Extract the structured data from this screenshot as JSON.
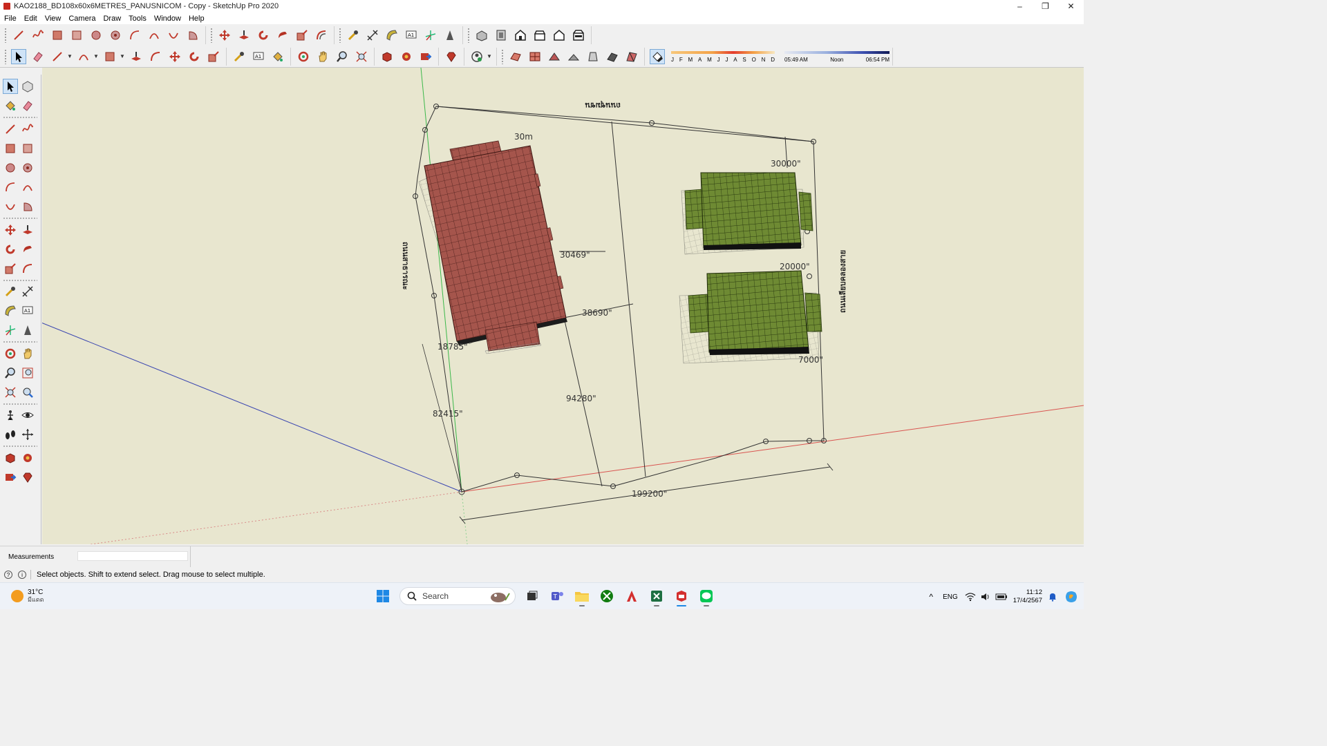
{
  "window": {
    "title": "KAO2188_BD108x60x6METRES_PANUSNICOM - Copy - SketchUp Pro 2020",
    "minimize": "–",
    "restore": "❐",
    "close": "✕"
  },
  "menu": [
    "File",
    "Edit",
    "View",
    "Camera",
    "Draw",
    "Tools",
    "Window",
    "Help"
  ],
  "toolbar_row1_icons": [
    "line-icon",
    "freehand-icon",
    "rectangle-icon",
    "rotated-rectangle-icon",
    "circle-icon",
    "polygon-icon",
    "arc-icon",
    "2pt-arc-icon",
    "3pt-arc-icon",
    "pie-icon",
    "move-icon",
    "push-pull-icon",
    "rotate-icon",
    "follow-me-icon",
    "scale-icon",
    "offset-icon",
    "tape-measure-icon",
    "dimension-icon",
    "protractor-icon",
    "text-icon",
    "axes-icon",
    "3d-text-icon",
    "iso-view-icon",
    "top-view-icon",
    "front-view-icon",
    "right-view-icon",
    "back-view-icon",
    "left-view-icon"
  ],
  "shadows": {
    "months": [
      "J",
      "F",
      "M",
      "A",
      "M",
      "J",
      "J",
      "A",
      "S",
      "O",
      "N",
      "D"
    ],
    "time_start": "05:49 AM",
    "time_mid": "Noon",
    "time_end": "06:54 PM"
  },
  "canvas": {
    "road_top": "ถนนชุมชน",
    "road_left": "ถนนสาธารณะ",
    "road_right": "ถนนเลียบคลองสาย",
    "dims": {
      "d30m": "30m",
      "d30000": "30000\"",
      "d30469": "30469\"",
      "d20000": "20000\"",
      "d38690": "38690\"",
      "d18785": "18785\"",
      "d7000": "7000\"",
      "d94280": "94280\"",
      "d82415": "82415\"",
      "d199200": "199200\""
    }
  },
  "measurements": {
    "label": "Measurements",
    "value": ""
  },
  "status": {
    "text": "Select objects. Shift to extend select. Drag mouse to select multiple."
  },
  "taskbar": {
    "weather_temp": "31°C",
    "weather_desc": "มีแดด",
    "search_placeholder": "Search",
    "lang": "ENG",
    "time": "11:12",
    "date": "17/4/2567"
  },
  "colors": {
    "canvas_bg": "#e8e6cf",
    "roof_red": "#a8574f",
    "roof_green": "#6f8a32",
    "axis_red": "#d9534f",
    "axis_green": "#3bb84a",
    "axis_blue": "#3a46b0"
  }
}
